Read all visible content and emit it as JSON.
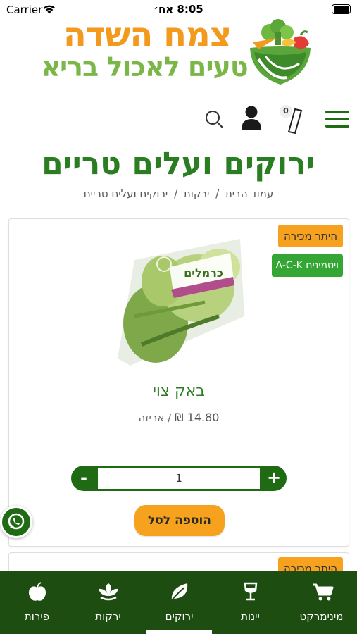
{
  "status_bar": {
    "carrier": "Carrier",
    "time": "8:05 אח׳"
  },
  "logo": {
    "line1": "צמח השדה",
    "line2": "טעים לאכול בריא"
  },
  "header": {
    "cart_count": "0"
  },
  "page": {
    "title": "ירוקים ועלים טריים",
    "breadcrumb": [
      "עמוד הבית",
      "ירקות",
      "ירוקים ועלים טריים"
    ],
    "breadcrumb_separator": "/"
  },
  "product": {
    "badge_popular": "היתר מכירה",
    "badge_vitamins": "ויטמינים A-C-K",
    "image_label": "כרמלים",
    "name": "באק צוי",
    "price": "14.80 ₪",
    "unit": "/ אריזה",
    "quantity": "1",
    "minus_label": "-",
    "plus_label": "+",
    "add_to_cart": "הוספה לסל"
  },
  "next_product": {
    "badge_popular": "היתר מכירה"
  },
  "bottom_nav": {
    "items": [
      {
        "label": "מינימרקט",
        "icon": "cart-icon"
      },
      {
        "label": "יינות",
        "icon": "wine-glass-icon"
      },
      {
        "label": "ירוקים",
        "icon": "leaf-icon"
      },
      {
        "label": "ירקות",
        "icon": "sprout-icon"
      },
      {
        "label": "פירות",
        "icon": "apple-icon"
      }
    ],
    "active_label": "ירוקים"
  },
  "colors": {
    "primary_green": "#1e6b14",
    "title_green": "#2b7d22",
    "orange": "#f7a21e",
    "nav_bg": "#1e4d12"
  }
}
